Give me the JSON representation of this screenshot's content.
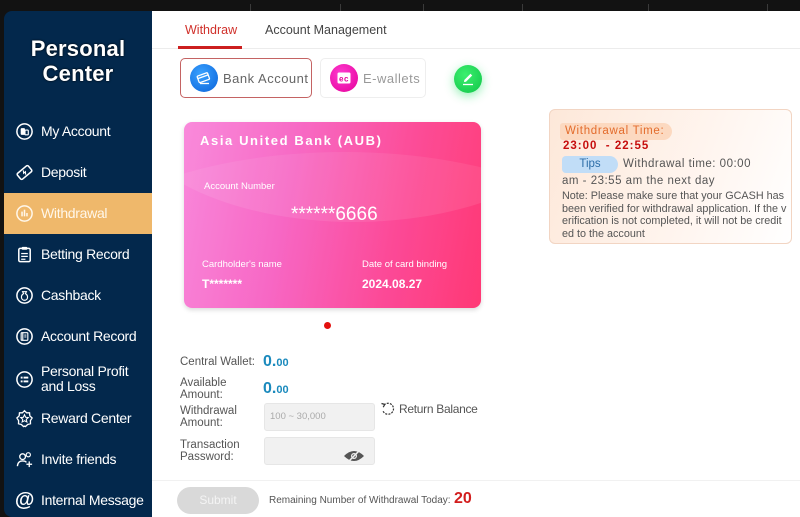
{
  "sidebar": {
    "title_line1": "Personal",
    "title_line2": "Center",
    "items": [
      {
        "label": "My Account",
        "icon": "my-account-icon",
        "active": false
      },
      {
        "label": "Deposit",
        "icon": "deposit-icon",
        "active": false
      },
      {
        "label": "Withdrawal",
        "icon": "withdrawal-icon",
        "active": true
      },
      {
        "label": "Betting Record",
        "icon": "betting-record-icon",
        "active": false
      },
      {
        "label": "Cashback",
        "icon": "cashback-icon",
        "active": false
      },
      {
        "label": "Account Record",
        "icon": "account-record-icon",
        "active": false
      },
      {
        "label": "Personal Profit and Loss",
        "icon": "profit-loss-icon",
        "active": false
      },
      {
        "label": "Reward Center",
        "icon": "reward-center-icon",
        "active": false
      },
      {
        "label": "Invite friends",
        "icon": "invite-friends-icon",
        "active": false
      },
      {
        "label": "Internal Message",
        "icon": "internal-message-icon",
        "active": false
      }
    ]
  },
  "tabs": [
    {
      "label": "Withdraw",
      "active": true
    },
    {
      "label": "Account Management",
      "active": false
    }
  ],
  "methods": {
    "bank": {
      "label": "Bank Account",
      "selected": true
    },
    "ewallet": {
      "label": "E-wallets",
      "selected": false
    }
  },
  "card": {
    "bank_name": "Asia United Bank (AUB)",
    "account_number_label": "Account Number",
    "account_number": "******6666",
    "holder_label": "Cardholder's name",
    "holder_value": "T*******",
    "date_label": "Date of card binding",
    "date_value": "2024.08.27"
  },
  "info": {
    "withdrawal_time_title": "Withdrawal Time:",
    "withdrawal_time_range": "23:00  - 22:55",
    "tips_label": "Tips",
    "tip_line1": "Withdrawal time: 00:00",
    "tip_line2": "am - 23:55 am the next day",
    "note": "Note: Please make sure that your GCASH has been verified for withdrawal application. If the verification is not completed, it will not be credited to the account"
  },
  "form": {
    "central_wallet_label": "Central Wallet:",
    "central_wallet_int": "0.",
    "central_wallet_dec": "00",
    "available_label_1": "Available",
    "available_label_2": "Amount:",
    "available_int": "0.",
    "available_dec": "00",
    "withdrawal_label_1": "Withdrawal",
    "withdrawal_label_2": "Amount:",
    "withdrawal_placeholder": "100 ~ 30,000",
    "return_balance": "Return Balance",
    "password_label_1": "Transaction",
    "password_label_2": "Password:",
    "password_value": ""
  },
  "footer": {
    "submit_label": "Submit",
    "remaining_label": "Remaining Number of Withdrawal Today:",
    "remaining_count": "20"
  },
  "colors": {
    "sidebar_bg": "#03284c",
    "active_item": "#efb86b",
    "accent_red": "#cc1f1f",
    "amount_blue": "#1b8abd"
  }
}
